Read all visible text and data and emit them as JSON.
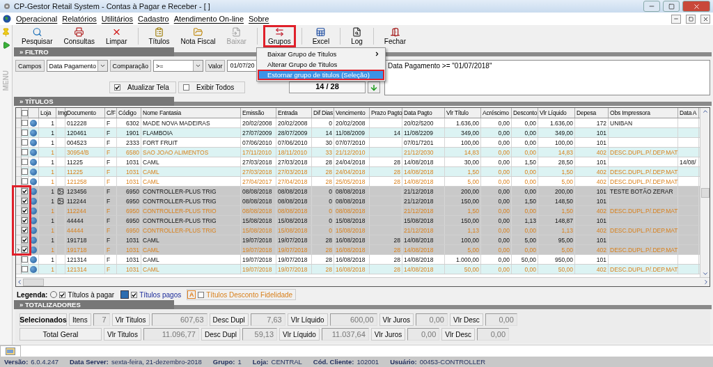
{
  "window": {
    "title": "CP-Gestor Retail System - Contas à Pagar e Receber - [ ]"
  },
  "menu": [
    "Operacional",
    "Relatórios",
    "Utilitários",
    "Cadastro",
    "Atendimento On-line",
    "Sobre"
  ],
  "sidebar": {
    "label": "MENU"
  },
  "toolbar": [
    {
      "label": "Pesquisar",
      "disabled": false,
      "highlighted": false
    },
    {
      "label": "Consultas",
      "disabled": false,
      "highlighted": false
    },
    {
      "label": "Limpar",
      "disabled": false,
      "highlighted": false
    },
    {
      "label": "Títulos",
      "disabled": false,
      "highlighted": false
    },
    {
      "label": "Nota Fiscal",
      "disabled": false,
      "highlighted": false
    },
    {
      "label": "Baixar",
      "disabled": true,
      "highlighted": false
    },
    {
      "label": "Grupos",
      "disabled": false,
      "highlighted": true
    },
    {
      "label": "Excel",
      "disabled": false,
      "highlighted": false
    },
    {
      "label": "Log",
      "disabled": false,
      "highlighted": false
    },
    {
      "label": "Fechar",
      "disabled": false,
      "highlighted": false
    }
  ],
  "dropdown": [
    {
      "label": "Baixar Grupo de Titulos",
      "submenu": true,
      "selected": false,
      "highlighted": false
    },
    {
      "label": "Alterar Grupo de Titulos",
      "submenu": false,
      "selected": false,
      "highlighted": false
    },
    {
      "label": "Estornar grupo de titulos (Seleção)",
      "submenu": false,
      "selected": true,
      "highlighted": true
    }
  ],
  "filter": {
    "title": "» FILTRO",
    "campos_button": "Campos",
    "campo": "Data Pagamento",
    "comparacao_button": "Comparação",
    "comparacao": ">=",
    "valor_button": "Valor",
    "valor": "01/07/20",
    "atualizar": {
      "label": "Atualizar Tela",
      "checked": true
    },
    "exibir": {
      "label": "Exibir Todos",
      "checked": false
    },
    "counter": "14 / 28",
    "expression": "Data Pagamento >= \"01/07/2018\""
  },
  "table": {
    "title": "» TÍTULOS",
    "all_checked": false,
    "checkbox_column_highlighted": true,
    "columns": [
      "Loja",
      "Img",
      "Documento",
      "C/F",
      "Código",
      "Nome Fantasia",
      "Emissão",
      "Entrada",
      "Dif Dias",
      "Vencimento",
      "Prazo Pagto",
      "Data Pagto",
      "Vlr Título",
      "Acréscimo",
      "Desconto",
      "Vlr Líquido",
      "Depesa",
      "Obs Impressora",
      "Data A"
    ],
    "rows": [
      {
        "checked": false,
        "current": false,
        "kind": "normal",
        "image": false,
        "cells": [
          "1",
          null,
          "012228",
          "F",
          "6302",
          "MADE NOVA MADEIRAS",
          "20/02/2008",
          "20/02/2008",
          "0",
          "20/02/2008",
          null,
          "20/02/5200",
          "1.636,00",
          "0,00",
          "0,00",
          "1.636,00",
          "172",
          "UNIBAN",
          null
        ]
      },
      {
        "checked": false,
        "current": false,
        "kind": "normal",
        "image": false,
        "cells": [
          "1",
          null,
          "120461",
          "F",
          "1901",
          "FLAMBOIA",
          "27/07/2009",
          "28/07/2009",
          "14",
          "11/08/2009",
          "14",
          "11/08/2209",
          "349,00",
          "0,00",
          "0,00",
          "349,00",
          "101",
          null,
          null
        ]
      },
      {
        "checked": false,
        "current": false,
        "kind": "normal",
        "image": false,
        "cells": [
          "1",
          null,
          "004523",
          "F",
          "2333",
          "FORT FRUIT",
          "07/06/2010",
          "07/06/2010",
          "30",
          "07/07/2010",
          null,
          "07/01/7201",
          "100,00",
          "0,00",
          "0,00",
          "100,00",
          "101",
          null,
          null
        ]
      },
      {
        "checked": false,
        "current": false,
        "kind": "desconto",
        "image": false,
        "cells": [
          "1",
          null,
          "30954/B",
          "F",
          "6580",
          "SAO JOAO ALIMENTOS",
          "17/11/2010",
          "18/11/2010",
          "33",
          "21/12/2010",
          null,
          "21/12/2030",
          "14,83",
          "0,00",
          "0,00",
          "14,83",
          "402",
          "DESC.DUPL.P/.DEP.MAT",
          null
        ]
      },
      {
        "checked": false,
        "current": false,
        "kind": "normal",
        "image": false,
        "cells": [
          "1",
          null,
          "11225",
          "F",
          "1031",
          "CAML",
          "27/03/2018",
          "27/03/2018",
          "28",
          "24/04/2018",
          "28",
          "14/08/2018",
          "30,00",
          "0,00",
          "1,50",
          "28,50",
          "101",
          null,
          "14/08/"
        ]
      },
      {
        "checked": false,
        "current": false,
        "kind": "desconto",
        "image": false,
        "cells": [
          "1",
          null,
          "11225",
          "F",
          "1031",
          "CAML",
          "27/03/2018",
          "27/03/2018",
          "28",
          "24/04/2018",
          "28",
          "14/08/2018",
          "1,50",
          "0,00",
          "0,00",
          "1,50",
          "402",
          "DESC.DUPL.P/.DEP.MAT",
          null
        ]
      },
      {
        "checked": false,
        "current": false,
        "kind": "desconto",
        "image": false,
        "cells": [
          "1",
          null,
          "121258",
          "F",
          "1031",
          "CAML",
          "27/04/2017",
          "27/04/2018",
          "28",
          "25/05/2018",
          "28",
          "14/08/2018",
          "5,00",
          "0,00",
          "0,00",
          "5,00",
          "402",
          "DESC.DUPL.P/.DEP.MAT",
          null
        ]
      },
      {
        "checked": true,
        "current": false,
        "kind": "normal",
        "image": true,
        "cells": [
          "1",
          null,
          "123456",
          "F",
          "6950",
          "CONTROLLER-PLUS TRIG",
          "08/08/2018",
          "08/08/2018",
          "0",
          "08/08/2018",
          null,
          "21/12/2018",
          "200,00",
          "0,00",
          "0,00",
          "200,00",
          "101",
          "TESTE BOTÃO ZERAR",
          null
        ]
      },
      {
        "checked": true,
        "current": false,
        "kind": "normal",
        "image": true,
        "cells": [
          "1",
          null,
          "112244",
          "F",
          "6950",
          "CONTROLLER-PLUS TRIG",
          "08/08/2018",
          "08/08/2018",
          "0",
          "08/08/2018",
          null,
          "21/12/2018",
          "150,00",
          "0,00",
          "1,50",
          "148,50",
          "101",
          null,
          null
        ]
      },
      {
        "checked": true,
        "current": false,
        "kind": "desconto",
        "image": false,
        "cells": [
          "1",
          null,
          "112244",
          "F",
          "6950",
          "CONTROLLER-PLUS TRIO",
          "08/08/2018",
          "08/08/2018",
          "0",
          "08/08/2018",
          null,
          "21/12/2018",
          "1,50",
          "0,00",
          "0,00",
          "1,50",
          "402",
          "DESC.DUPL.P/.DEP.MAT",
          null
        ]
      },
      {
        "checked": true,
        "current": false,
        "kind": "normal",
        "image": false,
        "cells": [
          "1",
          null,
          "44444",
          "F",
          "6950",
          "CONTROLLER-PLUS TRIG",
          "15/08/2018",
          "15/08/2018",
          "0",
          "15/08/2018",
          null,
          "15/08/2018",
          "150,00",
          "0,00",
          "1,13",
          "148,87",
          "101",
          null,
          null
        ]
      },
      {
        "checked": true,
        "current": false,
        "kind": "desconto",
        "image": false,
        "cells": [
          "1",
          null,
          "44444",
          "F",
          "6950",
          "CONTROLLER-PLUS TRIG",
          "15/08/2018",
          "15/08/2018",
          "0",
          "15/08/2018",
          null,
          "21/12/2018",
          "1,13",
          "0,00",
          "0,00",
          "1,13",
          "402",
          "DESC.DUPL.P/.DEP.MAT",
          null
        ]
      },
      {
        "checked": true,
        "current": false,
        "kind": "normal",
        "image": false,
        "cells": [
          "1",
          null,
          "191718",
          "F",
          "1031",
          "CAML",
          "19/07/2018",
          "19/07/2018",
          "28",
          "16/08/2018",
          "28",
          "14/08/2018",
          "100,00",
          "0,00",
          "5,00",
          "95,00",
          "101",
          null,
          null
        ]
      },
      {
        "checked": true,
        "current": true,
        "kind": "desconto",
        "image": false,
        "cells": [
          "1",
          null,
          "191718",
          "F",
          "1031",
          "CAML",
          "19/07/2018",
          "19/07/2018",
          "28",
          "16/08/2018",
          "28",
          "14/08/2018",
          "5,00",
          "0,00",
          "0,00",
          "5,00",
          "402",
          "DESC.DUPL.P/.DEP.MAT",
          null
        ]
      },
      {
        "checked": false,
        "current": false,
        "kind": "normal",
        "image": false,
        "cells": [
          "1",
          null,
          "121314",
          "F",
          "1031",
          "CAML",
          "19/07/2018",
          "19/07/2018",
          "28",
          "16/08/2018",
          "28",
          "14/08/2018",
          "1.000,00",
          "0,00",
          "50,00",
          "950,00",
          "101",
          null,
          null
        ]
      },
      {
        "checked": false,
        "current": false,
        "kind": "desconto",
        "image": false,
        "cells": [
          "1",
          null,
          "121314",
          "F",
          "1031",
          "CAML",
          "19/07/2018",
          "19/07/2018",
          "28",
          "16/08/2018",
          "28",
          "14/08/2018",
          "50,00",
          "0,00",
          "0,00",
          "50,00",
          "402",
          "DESC.DUPL.P/.DEP.MAT",
          null
        ]
      }
    ]
  },
  "legend": {
    "label": "Legenda:",
    "items": [
      {
        "kind": "pagar",
        "label": "Títulos à pagar",
        "checked": true
      },
      {
        "kind": "pagos",
        "label": "Títulos pagos",
        "checked": true
      },
      {
        "kind": "fidelidade",
        "marker": "A",
        "label": "Títulos Desconto Fidelidade",
        "checked": false
      }
    ]
  },
  "totals": {
    "title": "» TOTALIZADORES",
    "rows": [
      {
        "kind": "selected",
        "title": "Selecionados",
        "items_label": "Itens",
        "items": "7",
        "fields": [
          {
            "label": "Vlr Titulos",
            "value": "607,63"
          },
          {
            "label": "Desc Dupl",
            "value": "7,63"
          },
          {
            "label": "Vlr Líquido",
            "value": "600,00"
          },
          {
            "label": "Vlr Juros",
            "value": "0,00"
          },
          {
            "label": "Vlr Desc",
            "value": "0,00"
          }
        ]
      },
      {
        "kind": "total",
        "title": "Total Geral",
        "fields": [
          {
            "label": "Vlr Titulos",
            "value": "11.096,77"
          },
          {
            "label": "Desc Dupl",
            "value": "59,13"
          },
          {
            "label": "Vlr Líquido",
            "value": "11.037,64"
          },
          {
            "label": "Vlr Juros",
            "value": "0,00"
          },
          {
            "label": "Vlr Desc",
            "value": "0,00"
          }
        ]
      }
    ]
  },
  "status_bar": [
    {
      "label": "Versão:",
      "value": "6.0.4.247"
    },
    {
      "label": "Data Server:",
      "value": "sexta-feira, 21-dezembro-2018"
    },
    {
      "label": "Grupo:",
      "value": "1"
    },
    {
      "label": "Loja:",
      "value": "CENTRAL"
    },
    {
      "label": "Cód. Cliente:",
      "value": "102001"
    },
    {
      "label": "Usuário:",
      "value": "00453-CONTROLLER"
    }
  ]
}
